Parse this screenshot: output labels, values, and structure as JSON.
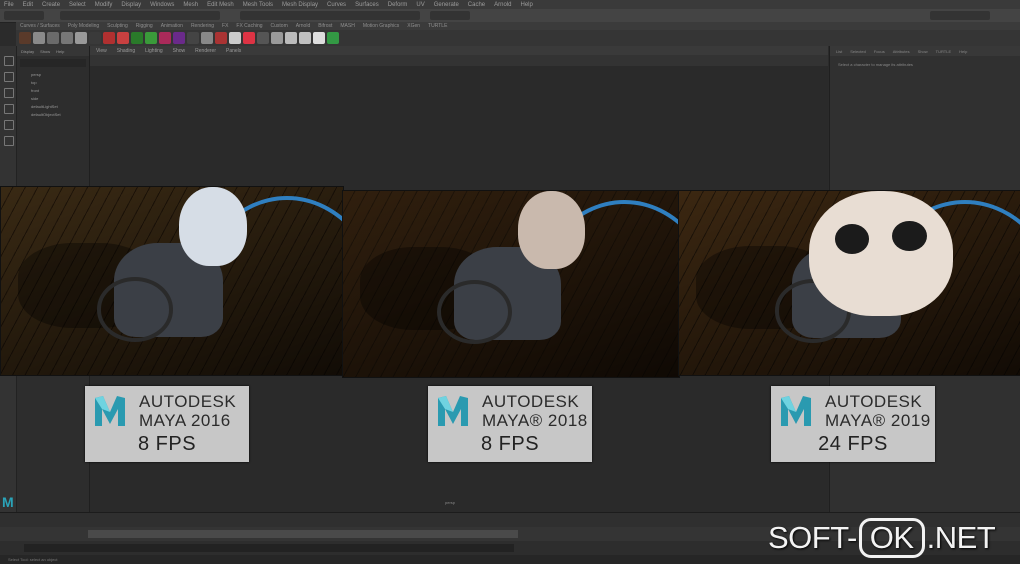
{
  "menubar": {
    "items": [
      "File",
      "Edit",
      "Create",
      "Select",
      "Modify",
      "Display",
      "Windows",
      "Mesh",
      "Edit Mesh",
      "Mesh Tools",
      "Mesh Display",
      "Curves",
      "Surfaces",
      "Deform",
      "UV",
      "Generate",
      "Cache",
      "Arnold",
      "Help"
    ]
  },
  "shelf": {
    "tabs": [
      "Curves / Surfaces",
      "Poly Modeling",
      "Sculpting",
      "Rigging",
      "Animation",
      "Rendering",
      "FX",
      "FX Caching",
      "Custom",
      "Arnold",
      "Bifrost",
      "MASH",
      "Motion Graphics",
      "XGen",
      "TURTLE"
    ],
    "icon_colors": [
      "#5a3a2a",
      "#8a8a8a",
      "#6a6a6a",
      "#777",
      "#999",
      "#3a3a3a",
      "#b03030",
      "#c84040",
      "#2a7a2a",
      "#3a9a3a",
      "#aa2a5a",
      "#6a2a8a",
      "#444",
      "#888",
      "#aa3333",
      "#cccccc",
      "#dd3344",
      "#555",
      "#9a9a9a",
      "#bbbbbb",
      "#c0c0c0",
      "#dddddd",
      "#339944"
    ]
  },
  "outliner": {
    "menu": [
      "Display",
      "Show",
      "Help"
    ],
    "rows": [
      "persp",
      "top",
      "front",
      "side",
      "defaultLightSet",
      "defaultObjectSet"
    ]
  },
  "viewport": {
    "menu": [
      "View",
      "Shading",
      "Lighting",
      "Show",
      "Renderer",
      "Panels"
    ],
    "camera": "persp"
  },
  "attr": {
    "tabs": [
      "List",
      "Selected",
      "Focus",
      "Attributes",
      "Show",
      "TURTLE",
      "Help"
    ],
    "hint": "Select a character to manage its attributes"
  },
  "renders": [
    {
      "name": "maya-2016",
      "skull": "#d6dde6",
      "floor": "#6a5a3c"
    },
    {
      "name": "maya-2018",
      "skull": "#c9b9ad",
      "floor": "#5a442a"
    },
    {
      "name": "maya-2019",
      "skull": "#e8ddd3",
      "floor": "#6e5534"
    }
  ],
  "labels": [
    {
      "brand": "AUTODESK",
      "product": "MAYA 2016",
      "fps": "8 FPS"
    },
    {
      "brand": "AUTODESK",
      "product": "MAYA® 2018",
      "fps": "8 FPS"
    },
    {
      "brand": "AUTODESK",
      "product": "MAYA® 2019",
      "fps": "24 FPS"
    }
  ],
  "watermark": {
    "left": "SOFT-",
    "ok": "OK",
    "right": ".NET"
  },
  "helpline": "Select Tool: select an object"
}
